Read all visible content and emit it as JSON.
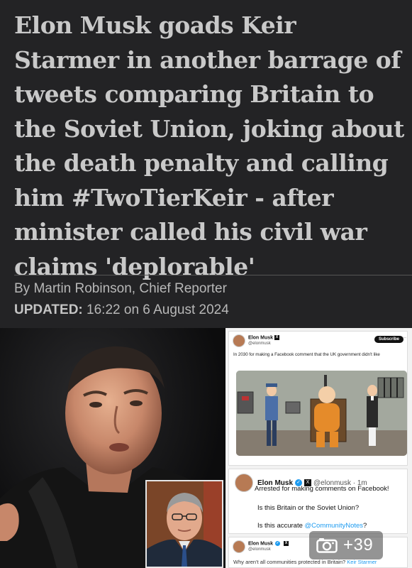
{
  "article": {
    "headline": "Elon Musk goads Keir Starmer in another barrage of tweets comparing Britain to the Soviet Union, joking about the death penalty and calling him #TwoTierKeir - after minister called his civil war claims 'deplorable'",
    "byline": "By Martin Robinson, Chief Reporter",
    "updated_label": "UPDATED:",
    "updated_value": "16:22 on 6 August 2024"
  },
  "tweet_card_1": {
    "name": "Elon Musk",
    "handle": "@elonmusk",
    "subscribe_label": "Subscribe",
    "more_label": "···",
    "text": "In 2030 for making a Facebook comment that the UK government didn't like"
  },
  "tweet_card_2": {
    "name": "Elon Musk",
    "handle_time": "@elonmusk · 1m",
    "line1": "Arrested for making comments on Facebook!",
    "line2": "Is this Britain or the Soviet Union?",
    "line3_prefix": "Is this accurate",
    "line3_mention": "@CommunityNotes",
    "line3_suffix": "?"
  },
  "tweet_card_3": {
    "name": "Elon Musk",
    "handle": "@elonmusk",
    "text": "Why aren't all communities protected in Britain?",
    "mention": "Keir Starmer"
  },
  "gallery": {
    "count": "+39",
    "icon": "camera-icon"
  },
  "images": {
    "main": "elon-musk-photo",
    "inset": "keir-starmer-photo",
    "cartoon": "cartoon-electric-chair-scene"
  }
}
